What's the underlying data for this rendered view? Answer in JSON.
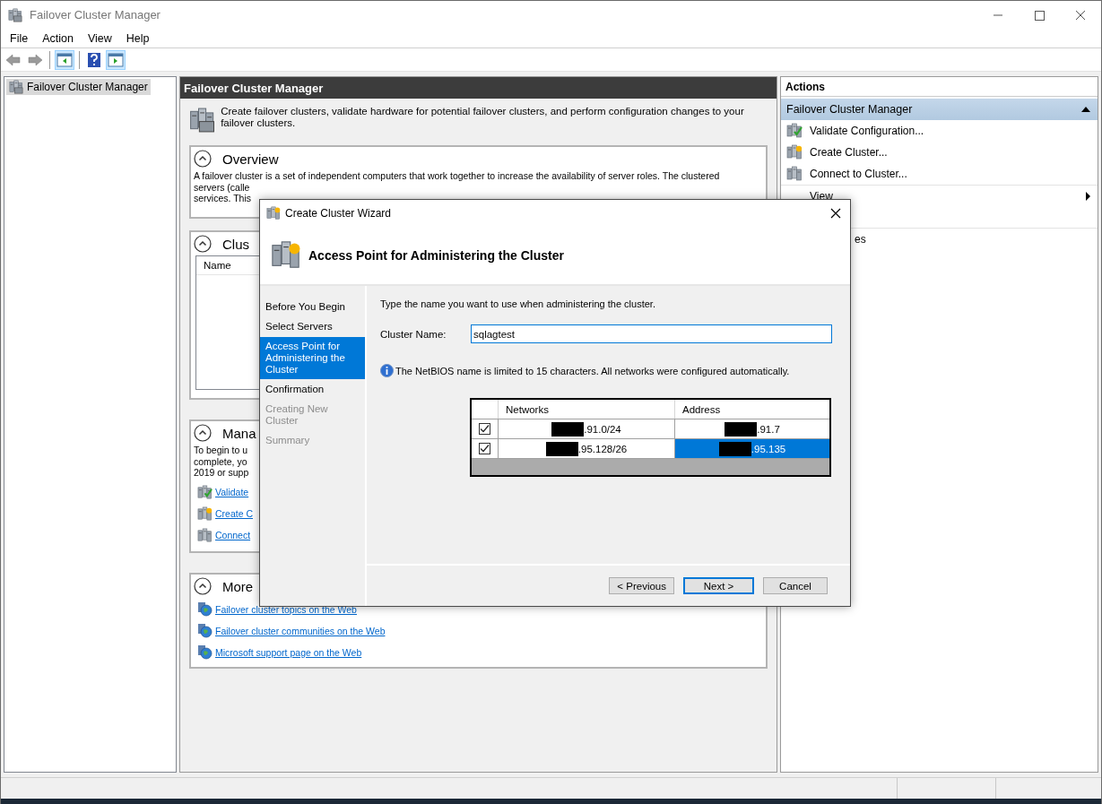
{
  "window": {
    "title": "Failover Cluster Manager"
  },
  "menu": [
    "File",
    "Action",
    "View",
    "Help"
  ],
  "toolbar": [
    {
      "kind": "back",
      "disabled": true
    },
    {
      "kind": "forward",
      "disabled": true
    },
    {
      "kind": "tree",
      "pressed": true
    },
    {
      "kind": "help",
      "pressed": false
    },
    {
      "kind": "actions",
      "pressed": true
    }
  ],
  "tree": {
    "items": [
      {
        "label": "Failover Cluster Manager",
        "selected": true
      }
    ]
  },
  "center": {
    "title": "Failover Cluster Manager",
    "description": "Create failover clusters, validate hardware for potential failover clusters, and perform configuration changes to your failover clusters.",
    "sections": [
      {
        "kind": "text",
        "title": "Overview",
        "expanded": true,
        "lines": [
          "A failover cluster is a set of independent computers that work together to increase the availability of server roles. The clustered",
          "servers (calle",
          "services. This"
        ]
      },
      {
        "kind": "table",
        "title": "Clus",
        "expanded": true,
        "columns": [
          "Name"
        ]
      },
      {
        "kind": "links",
        "title": "Mana",
        "expanded": true,
        "lines": [
          "To begin to u",
          "complete, yo",
          "2019 or supp"
        ],
        "links": [
          {
            "label": "Validate",
            "kind": "validate"
          },
          {
            "label": "Create C",
            "kind": "create"
          },
          {
            "label": "Connect",
            "kind": "connect"
          }
        ]
      },
      {
        "kind": "links",
        "title": "More",
        "expanded": true,
        "links": [
          {
            "label": "Failover cluster topics on the Web",
            "kind": "web"
          },
          {
            "label": "Failover cluster communities on the Web",
            "kind": "web"
          },
          {
            "label": "Microsoft support page on the Web",
            "kind": "web"
          }
        ]
      }
    ]
  },
  "actions": {
    "title": "Actions",
    "group": {
      "title": "Failover Cluster Manager",
      "expanded": true
    },
    "items": [
      {
        "label": "Validate Configuration...",
        "kind": "validate"
      },
      {
        "label": "Create Cluster...",
        "kind": "create"
      },
      {
        "label": "Connect to Cluster...",
        "kind": "connect"
      },
      {
        "label": "View",
        "kind": "submenu"
      },
      {
        "label": "es",
        "kind": "hidden-icon"
      }
    ]
  },
  "wizard": {
    "title": "Create Cluster Wizard",
    "heading": "Access Point for Administering the Cluster",
    "steps": [
      {
        "label": "Before You Begin",
        "selected": false,
        "disabled": false
      },
      {
        "label": "Select Servers",
        "selected": false,
        "disabled": false
      },
      {
        "label": "Access Point for Administering the Cluster",
        "selected": true,
        "disabled": false
      },
      {
        "label": "Confirmation",
        "selected": false,
        "disabled": false
      },
      {
        "label": "Creating New Cluster",
        "selected": false,
        "disabled": true
      },
      {
        "label": "Summary",
        "selected": false,
        "disabled": true
      }
    ],
    "instruction": "Type the name you want to use when administering the cluster.",
    "cluster_name": {
      "label": "Cluster Name:",
      "value": "sqlagtest"
    },
    "info": "The NetBIOS name is limited to 15 characters.  All networks were configured automatically.",
    "networks": {
      "columns": [
        "Networks",
        "Address"
      ],
      "rows": [
        {
          "checked": true,
          "network": ".91.0/24",
          "address": ".91.7",
          "selected": false
        },
        {
          "checked": true,
          "network": ".95.128/26",
          "address": ".95.135",
          "selected": true
        }
      ]
    },
    "buttons": [
      {
        "label": "< Previous",
        "default": false
      },
      {
        "label": "Next >",
        "default": true
      },
      {
        "label": "Cancel",
        "default": false
      }
    ]
  }
}
